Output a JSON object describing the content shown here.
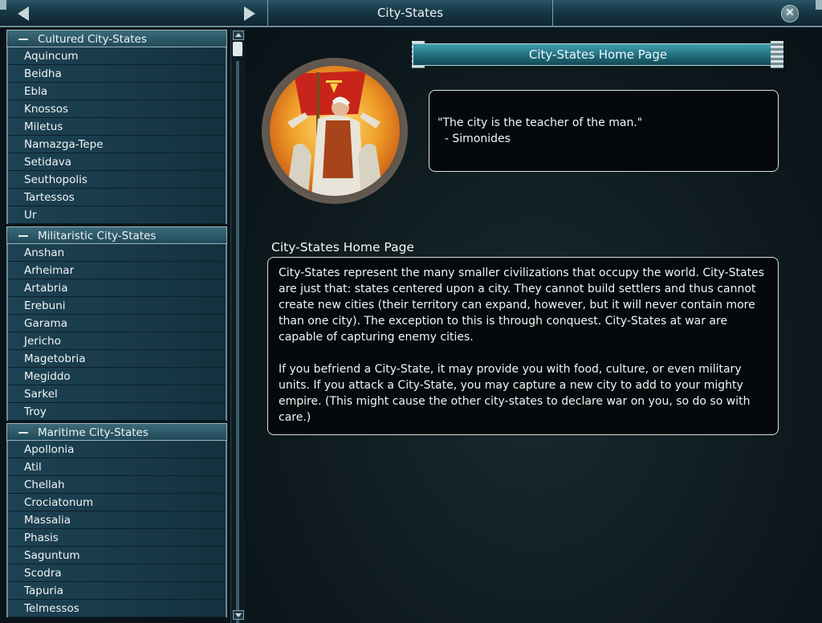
{
  "window": {
    "title": "City-States",
    "close_glyph": "✕"
  },
  "sidebar": {
    "categories": [
      {
        "label": "Cultured City-States",
        "items": [
          "Aquincum",
          "Beidha",
          "Ebla",
          "Knossos",
          "Miletus",
          "Namazga-Tepe",
          "Setidava",
          "Seuthopolis",
          "Tartessos",
          "Ur"
        ]
      },
      {
        "label": "Militaristic City-States",
        "items": [
          "Anshan",
          "Arheimar",
          "Artabria",
          "Erebuni",
          "Garama",
          "Jericho",
          "Magetobria",
          "Megiddo",
          "Sarkel",
          "Troy"
        ]
      },
      {
        "label": "Maritime City-States",
        "items": [
          "Apollonia",
          "Atil",
          "Chellah",
          "Crociatonum",
          "Massalia",
          "Phasis",
          "Saguntum",
          "Scodra",
          "Tapuria",
          "Telmessos"
        ]
      }
    ]
  },
  "main": {
    "banner": "City-States Home Page",
    "quote": "\"The city is the teacher of the man.\"",
    "quote_author": "  - Simonides",
    "section_title": "City-States Home Page",
    "paragraph1": "City-States represent the many smaller civilizations that occupy the world. City-States are just that: states centered upon a city. They cannot build settlers and thus cannot create new cities (their territory can expand, however, but it will never contain more than one city). The exception to this is through conquest. City-States at war are capable of capturing enemy cities.",
    "paragraph2": "If you befriend a City-State, it may provide you with food, culture, or even military units. If you attack a City-State, you may capture a new city to add to your mighty empire. (This might cause the other city-states to declare war on you, so do so with care.)"
  },
  "icons": [
    "back-arrow-icon",
    "forward-arrow-icon",
    "close-icon",
    "collapse-icon",
    "city-state-portrait"
  ]
}
